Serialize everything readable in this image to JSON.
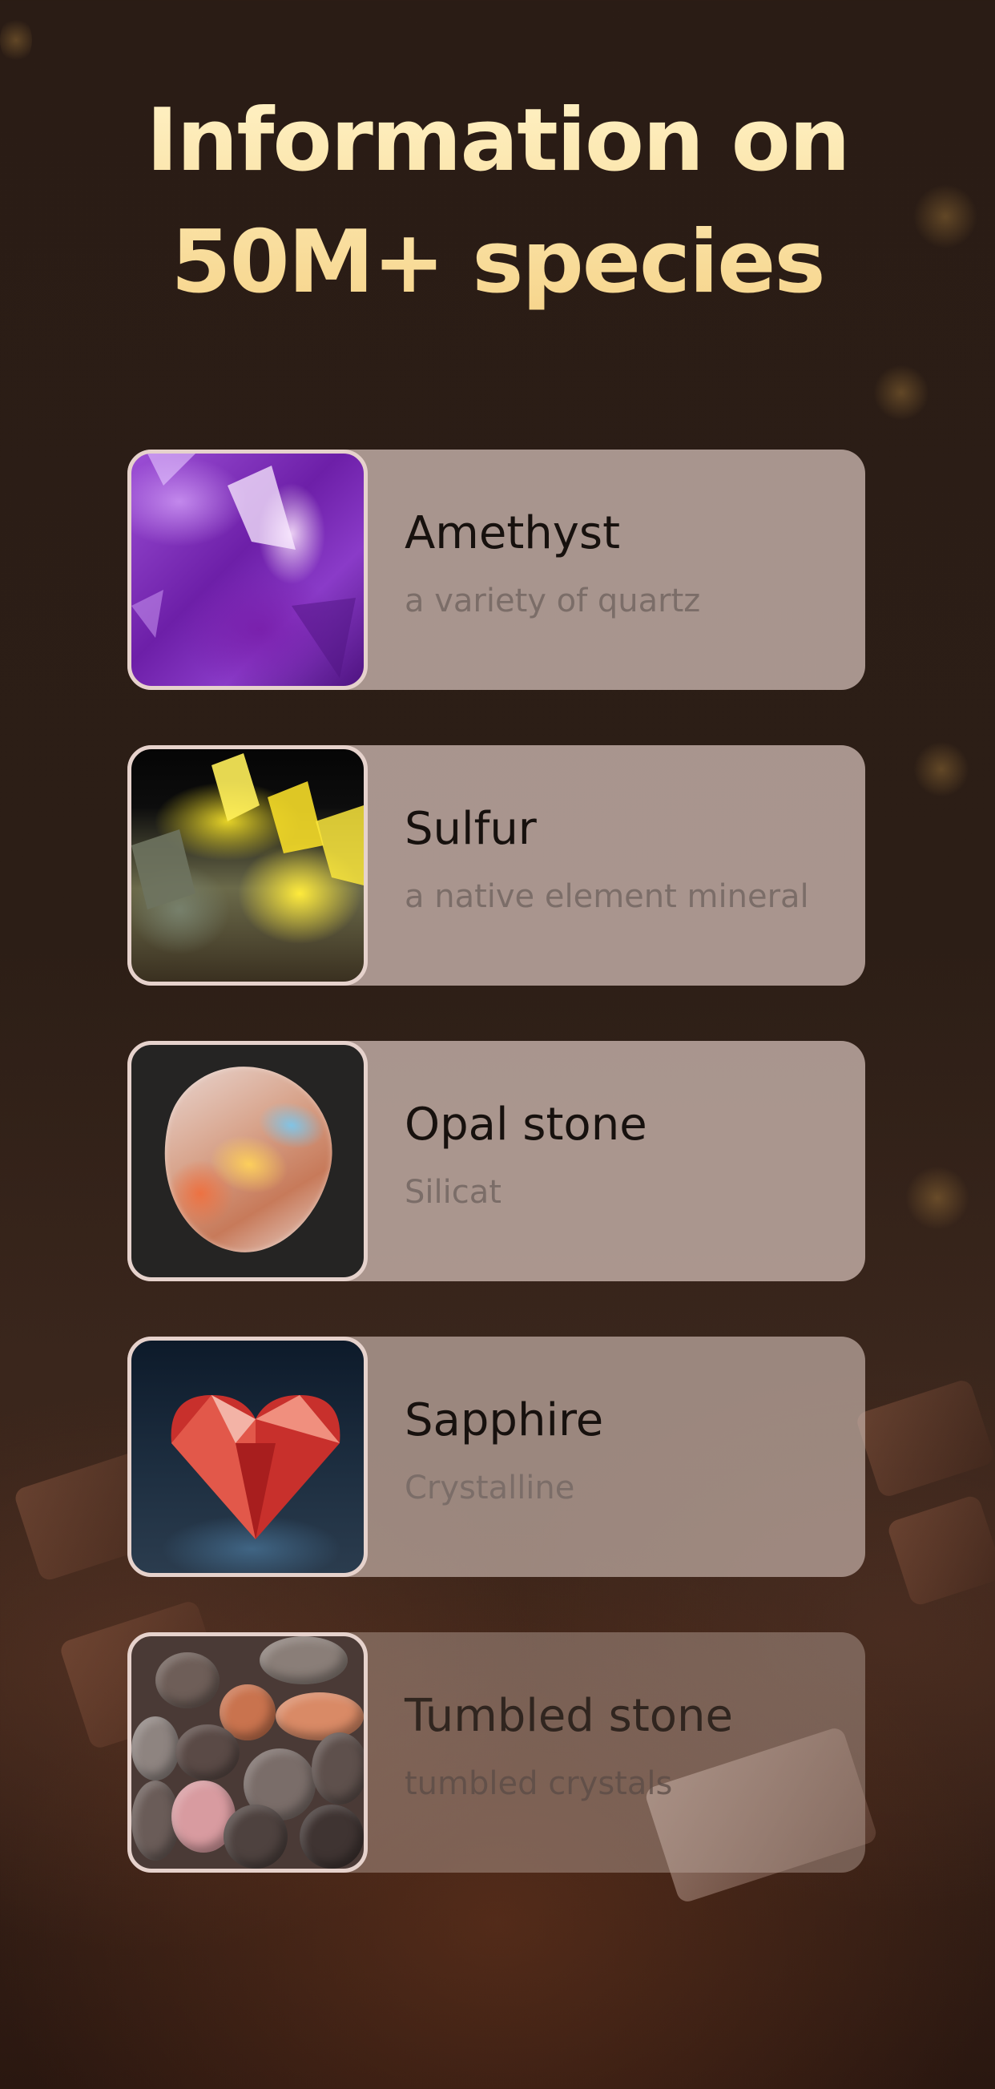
{
  "headline": {
    "line1": "Information on",
    "line2": "50M+ species"
  },
  "species": [
    {
      "name": "Amethyst",
      "description": "a variety of quartz",
      "image": "amethyst-crystal-photo"
    },
    {
      "name": "Sulfur",
      "description": "a native element mineral",
      "image": "sulfur-crystal-photo"
    },
    {
      "name": "Opal stone",
      "description": "Silicat",
      "image": "opal-stone-photo"
    },
    {
      "name": "Sapphire",
      "description": "Crystalline",
      "image": "red-heart-gem-photo"
    },
    {
      "name": "Tumbled stone",
      "description": "tumbled crystals",
      "image": "tumbled-pebbles-photo"
    }
  ],
  "colors": {
    "headline_top": "#fff2c6",
    "headline_bottom": "#f6d48a",
    "card_background": "#c4b0a8",
    "card_title": "#17110e",
    "card_subtitle": "#7b6d68",
    "thumb_border": "#e6d2cc"
  }
}
